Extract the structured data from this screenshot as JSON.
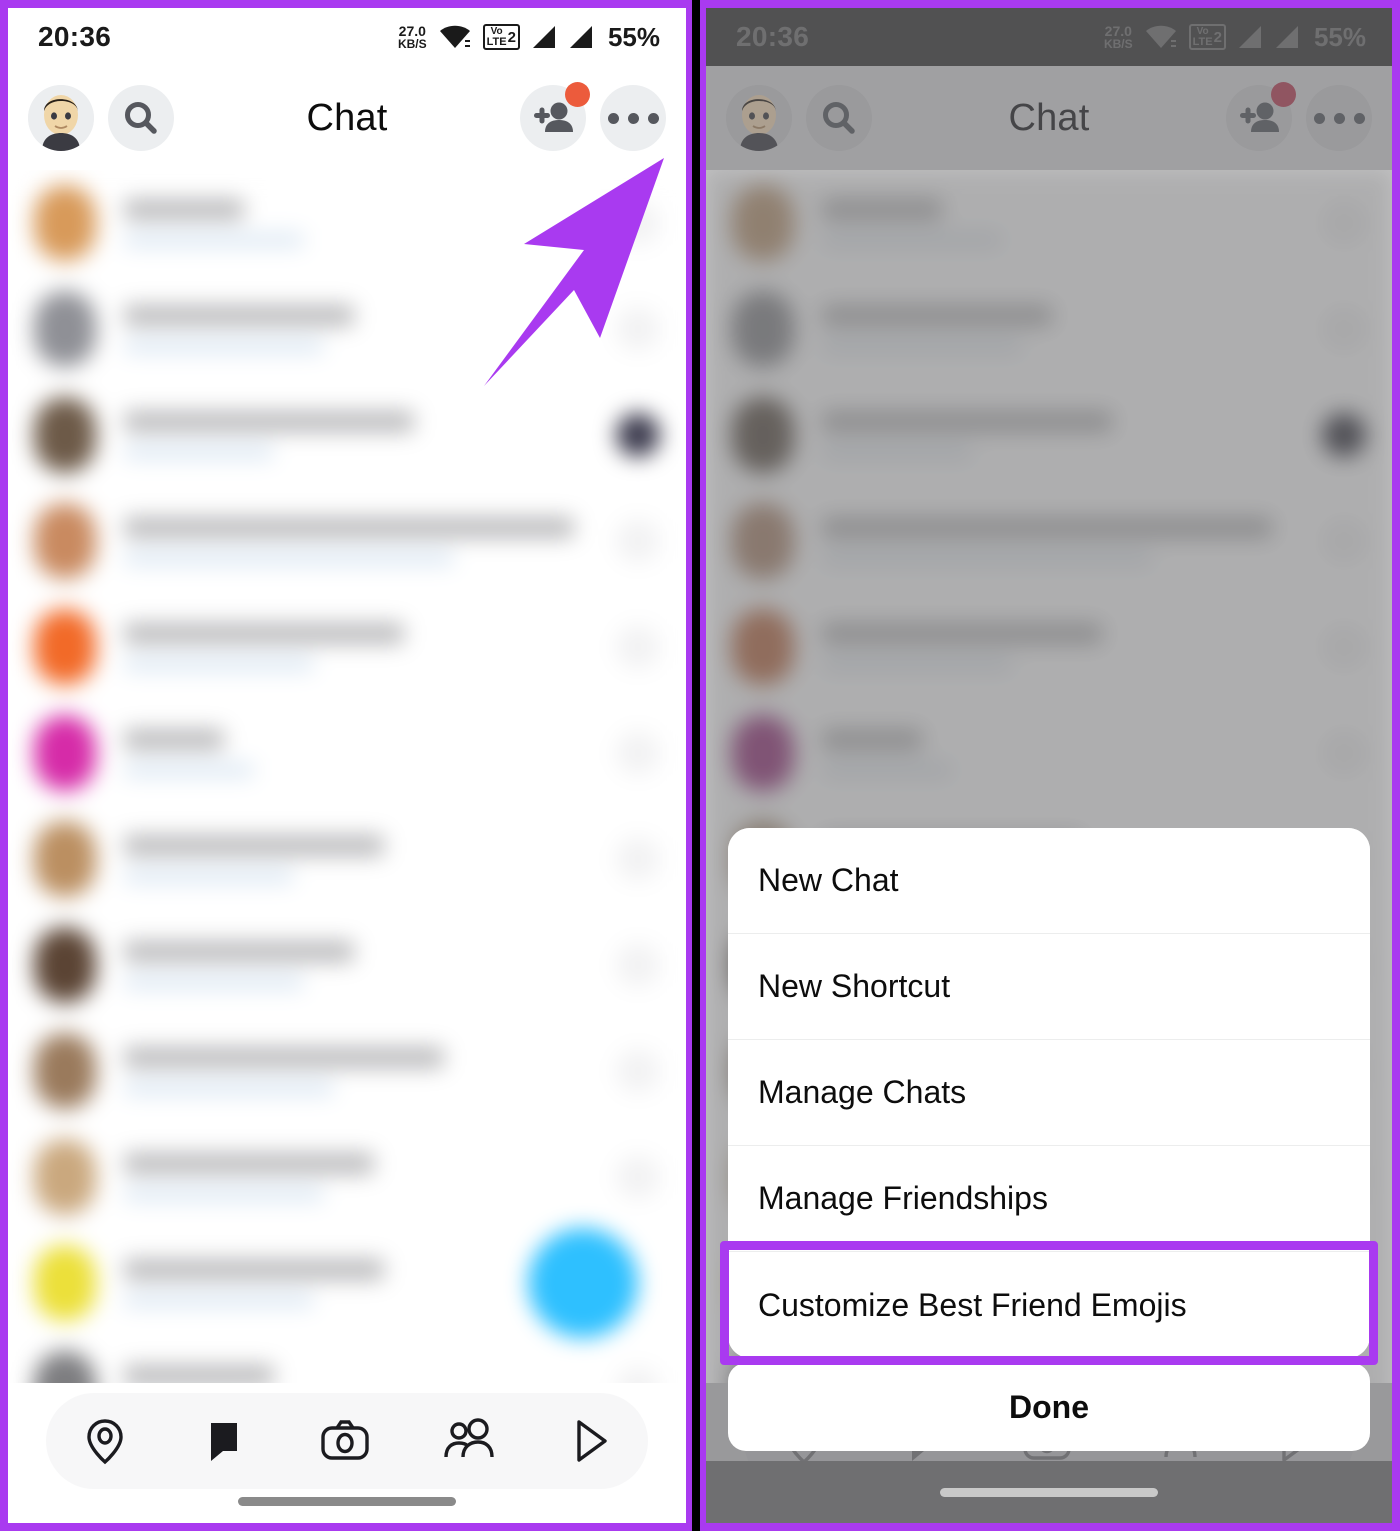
{
  "status_bar": {
    "time": "20:36",
    "network_speed_value": "27.0",
    "network_speed_unit": "KB/S",
    "wifi_icon": "wifi-icon",
    "volte_label_top": "Vo",
    "volte_label_bottom": "LTE",
    "volte_sim": "2",
    "signal_icon_1": "signal-bars-icon",
    "signal_icon_2": "signal-bars-icon",
    "battery": "55%"
  },
  "header": {
    "avatar_icon": "bitmoji-avatar",
    "search_icon": "search-icon",
    "title": "Chat",
    "add_friend_icon": "add-friend-icon",
    "add_friend_badge": "notification-dot",
    "more_icon": "more-options-icon"
  },
  "bottom_nav": {
    "items": [
      {
        "icon": "map-pin-icon",
        "label": "Map"
      },
      {
        "icon": "chat-bubble-icon",
        "label": "Chat",
        "active": true
      },
      {
        "icon": "camera-icon",
        "label": "Camera"
      },
      {
        "icon": "friends-icon",
        "label": "Friends"
      },
      {
        "icon": "play-spotlight-icon",
        "label": "Spotlight"
      }
    ]
  },
  "action_sheet": {
    "items": [
      {
        "label": "New Chat"
      },
      {
        "label": "New Shortcut"
      },
      {
        "label": "Manage Chats"
      },
      {
        "label": "Manage Friendships"
      },
      {
        "label": "Customize Best Friend Emojis",
        "highlighted": true
      }
    ],
    "done_label": "Done"
  },
  "annotations": {
    "arrow_icon": "pointer-arrow-icon",
    "arrow_color": "#a93af0",
    "highlight_color": "#a93af0",
    "frame_border_color": "#a93af0"
  },
  "chat_rows": [
    {
      "avatar_color": "#d89a5a",
      "right_icon": "chat-status-icon"
    },
    {
      "avatar_color": "#8f9096",
      "right_icon": "chat-status-icon"
    },
    {
      "avatar_color": "#6d5a48",
      "right_icon": "chat-status-icon-dark"
    },
    {
      "avatar_color": "#c98a60",
      "right_icon": "chat-status-icon"
    },
    {
      "avatar_color": "#f26a28",
      "right_icon": "chat-status-icon"
    },
    {
      "avatar_color": "#d62ba8",
      "right_icon": "chat-status-icon"
    },
    {
      "avatar_color": "#bb8f61",
      "right_icon": "chat-status-icon"
    },
    {
      "avatar_color": "#5b4434",
      "right_icon": "chat-status-icon"
    },
    {
      "avatar_color": "#9a7a5c",
      "right_icon": "chat-status-icon"
    },
    {
      "avatar_color": "#caa87e",
      "right_icon": "chat-status-icon"
    },
    {
      "avatar_color": "#ece03a",
      "right_icon": "new-chat-fab"
    },
    {
      "avatar_color": "#7d7d80",
      "right_icon": "chat-status-icon"
    }
  ]
}
